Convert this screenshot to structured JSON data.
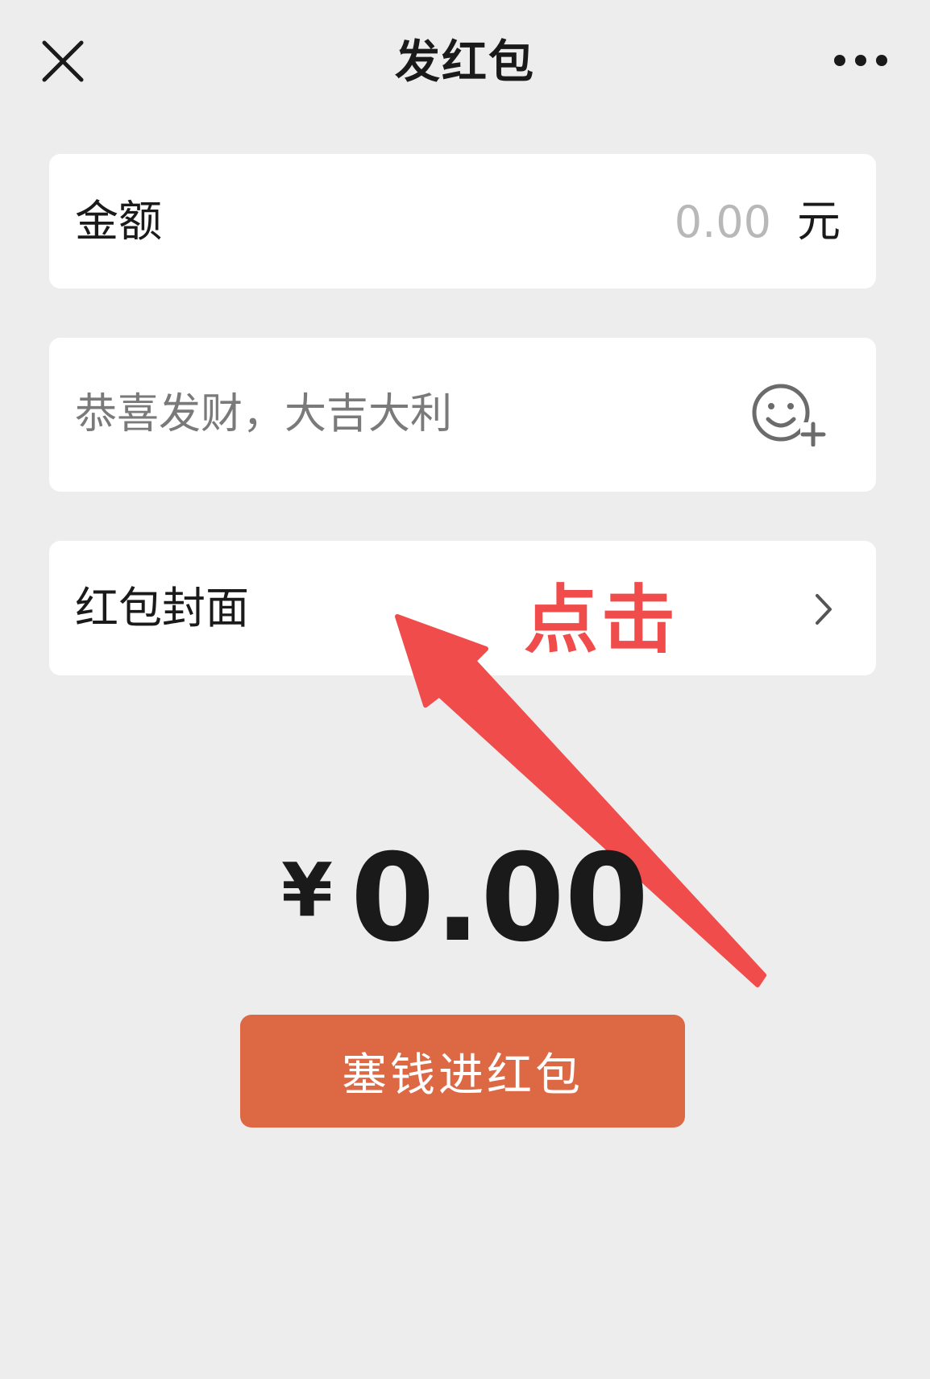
{
  "header": {
    "title": "发红包",
    "close_icon": "close-icon",
    "more_icon": "more-icon"
  },
  "amount": {
    "label": "金额",
    "placeholder": "0.00",
    "unit": "元"
  },
  "greeting": {
    "placeholder": "恭喜发财，大吉大利",
    "emoji_icon": "emoji-add-icon"
  },
  "cover": {
    "label": "红包封面",
    "chevron_icon": "chevron-right-icon"
  },
  "annotation": {
    "text": "点击",
    "color": "#f04c4c"
  },
  "total": {
    "currency": "¥",
    "value": "0.00"
  },
  "submit": {
    "label": "塞钱进红包",
    "color": "#dc6844"
  }
}
